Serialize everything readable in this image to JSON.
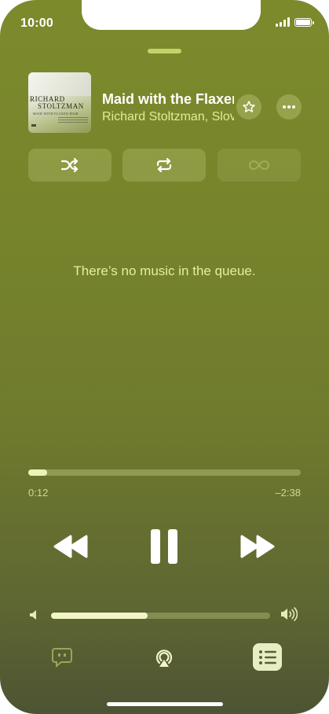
{
  "status_bar": {
    "time": "10:00"
  },
  "now_playing": {
    "title": "Maid with the Flaxen Hair",
    "artist": "Richard Stoltzman, Slovak Radio Symphony Orchestra",
    "artwork": {
      "line1": "RICHARD",
      "line2": "STOLTZMAN",
      "subtitle": "MAID WITH FLAXEN HAIR"
    }
  },
  "modes": {
    "shuffle_icon": "shuffle-icon",
    "repeat_icon": "repeat-icon",
    "autoplay_icon": "infinity-icon"
  },
  "queue": {
    "empty_message": "There’s no music in the queue."
  },
  "playback": {
    "elapsed": "0:12",
    "remaining": "–2:38",
    "progress_fraction": 0.07,
    "state": "playing"
  },
  "volume": {
    "level_fraction": 0.44
  },
  "colors": {
    "background": "#76832b",
    "accent": "#e3ec95",
    "control": "#ffffff"
  }
}
